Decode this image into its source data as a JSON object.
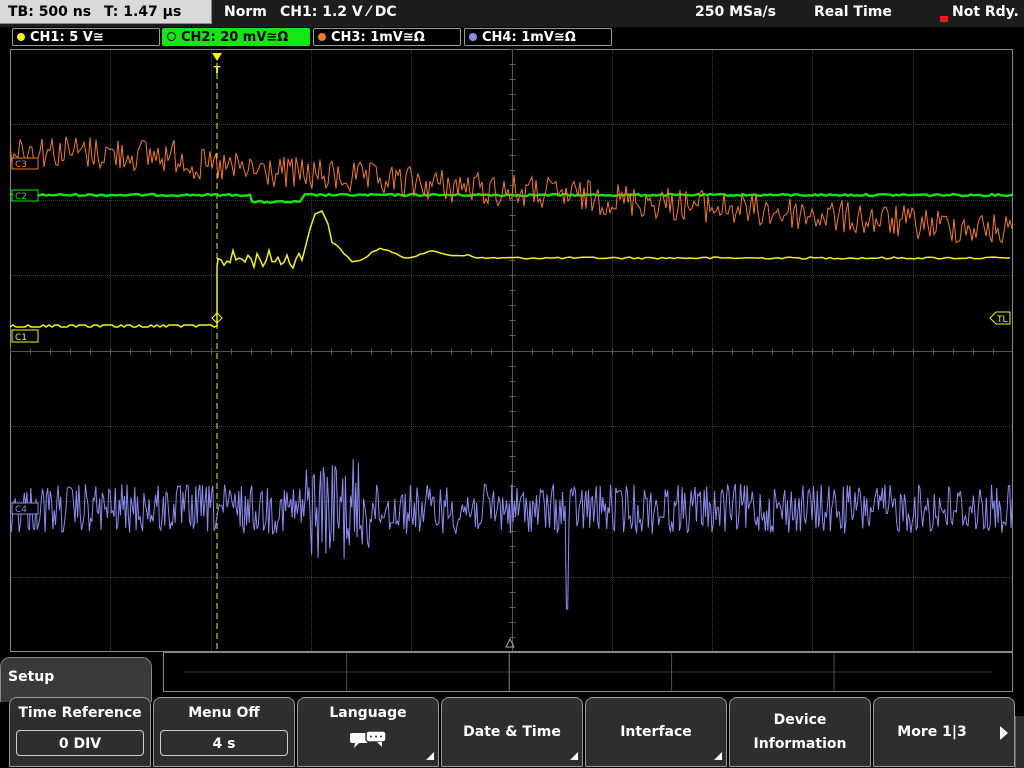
{
  "topbar": {
    "timebase": "TB: 500 ns",
    "trigger_time": "T: 1.47 µs",
    "mode": "Norm",
    "trigger_info": "CH1: 1.2 V ⁄ DC",
    "sample_rate": "250 MSa/s",
    "acq_mode": "Real Time",
    "status": "Not Rdy."
  },
  "channels": [
    {
      "id": "ch1",
      "label": "CH1: 5 V≅",
      "color": "#f2f21e"
    },
    {
      "id": "ch2",
      "label": "CH2: 20 mV≅Ω",
      "color": "#14e614"
    },
    {
      "id": "ch3",
      "label": "CH3: 1mV≅Ω",
      "color": "#f07a2a"
    },
    {
      "id": "ch4",
      "label": "CH4: 1mV≅Ω",
      "color": "#8c8cf0"
    }
  ],
  "markers": {
    "ch1": "C1",
    "ch2": "C2",
    "ch3": "C3",
    "ch4": "C4",
    "trigger_level": "TL",
    "trigger_top": "T"
  },
  "menu": {
    "title": "Setup",
    "softkeys": [
      {
        "label": "Time Reference",
        "value": "0 DIV"
      },
      {
        "label": "Menu Off",
        "value": "4 s"
      },
      {
        "label": "Language",
        "icon": "speech-bubble-icon"
      },
      {
        "label": "Date & Time"
      },
      {
        "label": "Interface"
      },
      {
        "label_line1": "Device",
        "label_line2": "Information"
      },
      {
        "label": "More 1|3"
      }
    ]
  }
}
